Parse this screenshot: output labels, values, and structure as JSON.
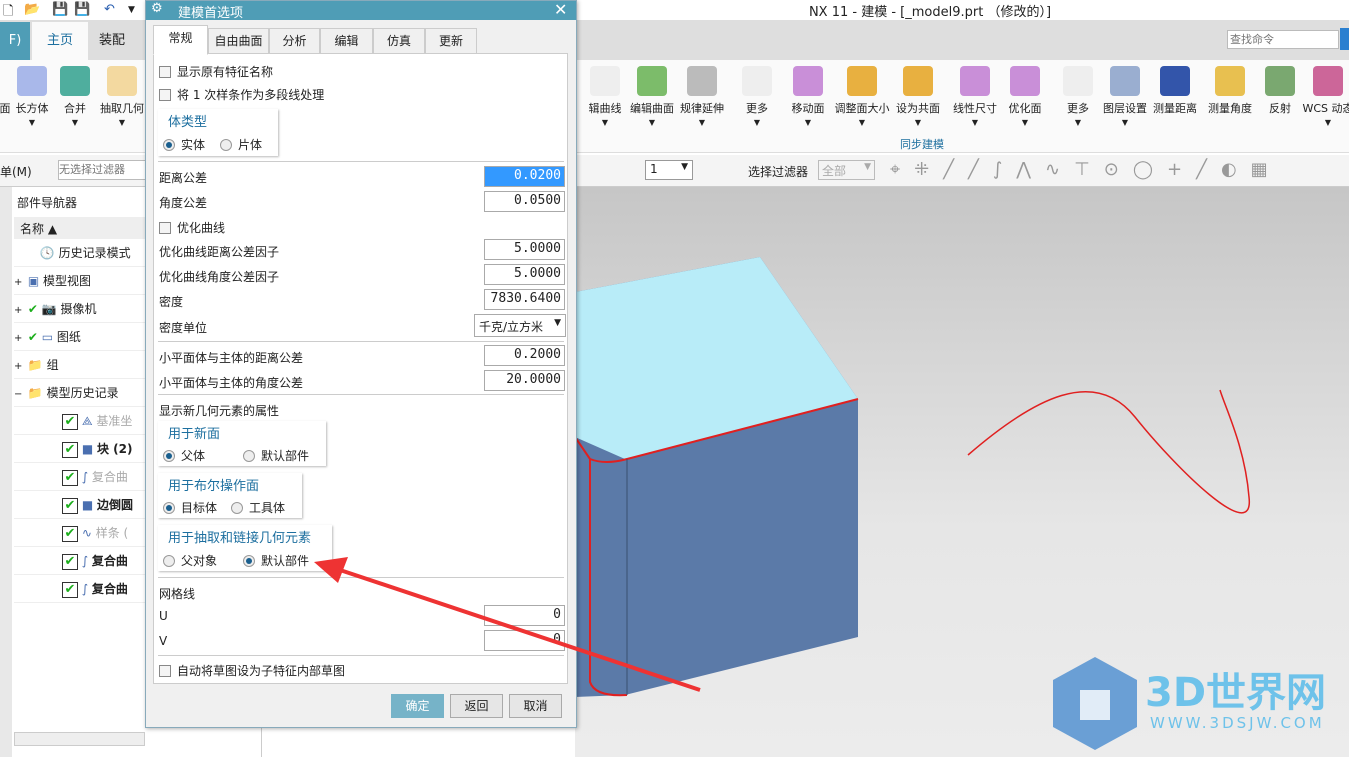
{
  "app": {
    "title": "NX 11 - 建模 - [_model9.prt （修改的）]"
  },
  "ribbon": {
    "file_tab": "F)",
    "tabs": [
      {
        "label": "主页",
        "selected": true
      },
      {
        "label": "装配"
      }
    ],
    "search_placeholder": "查找命令",
    "left_buttons": [
      "面",
      "长方体",
      "合并",
      "抽取几何"
    ],
    "right_buttons": [
      "辑曲线",
      "编辑曲面",
      "规律延伸",
      "更多",
      "移动面",
      "调整面大小",
      "设为共面",
      "线性尺寸",
      "优化面",
      "更多",
      "图层设置",
      "测量距离",
      "测量角度",
      "反射",
      "WCS 动态"
    ],
    "group_label": "同步建模"
  },
  "toolbar": {
    "menu": "单(M)",
    "filter_placeholder": "无选择过滤器",
    "layer_value": "1",
    "select_filter": "选择过滤器",
    "scope": "全部"
  },
  "navigator": {
    "title": "部件导航器",
    "col_header": "名称",
    "items": [
      "历史记录模式",
      "模型视图",
      "摄像机",
      "图纸",
      "组",
      "模型历史记录",
      "基准坐",
      "块 (2)",
      "复合曲",
      "边倒圆",
      "样条 (",
      "复合曲",
      "复合曲"
    ]
  },
  "dialog": {
    "title": "建模首选项",
    "tabs": [
      "常规",
      "自由曲面",
      "分析",
      "编辑",
      "仿真",
      "更新"
    ],
    "active_tab": "常规",
    "show_orig_names": "显示原有特征名称",
    "spline_polyline": "将 1 次样条作为多段线处理",
    "body_type": {
      "title": "体类型",
      "options": [
        "实体",
        "片体"
      ],
      "selected": "实体"
    },
    "dist_tol": {
      "label": "距离公差",
      "value": "0.0200"
    },
    "angle_tol": {
      "label": "角度公差",
      "value": "0.0500"
    },
    "optimize_curve": "优化曲线",
    "opt_dist": {
      "label": "优化曲线距离公差因子",
      "value": "5.0000"
    },
    "opt_angle": {
      "label": "优化曲线角度公差因子",
      "value": "5.0000"
    },
    "density": {
      "label": "密度",
      "value": "7830.6400"
    },
    "density_unit": {
      "label": "密度单位",
      "value": "千克/立方米"
    },
    "facet_dist": {
      "label": "小平面体与主体的距离公差",
      "value": "0.2000"
    },
    "facet_angle": {
      "label": "小平面体与主体的角度公差",
      "value": "20.0000"
    },
    "new_geom": "显示新几何元素的属性",
    "new_face": {
      "title": "用于新面",
      "options": [
        "父体",
        "默认部件"
      ],
      "selected": "父体"
    },
    "boolean_face": {
      "title": "用于布尔操作面",
      "options": [
        "目标体",
        "工具体"
      ],
      "selected": "目标体"
    },
    "extract": {
      "title": "用于抽取和链接几何元素",
      "options": [
        "父对象",
        "默认部件"
      ],
      "selected": "默认部件"
    },
    "grid": {
      "label": "网格线",
      "u_label": "U",
      "u": "0",
      "v_label": "V",
      "v": "0"
    },
    "auto_sketch": "自动将草图设为子特征内部草图",
    "ok": "确定",
    "back": "返回",
    "cancel": "取消"
  },
  "watermark": {
    "text": "3D世界网",
    "url": "WWW.3DSJW.COM"
  },
  "colors": {
    "dialog_title": "#4f9db6",
    "ok_button": "#76b3c8",
    "accent_text": "#1d6f9f",
    "arrow": "#ee3333",
    "body_face": "#5b7aa8",
    "top_face": "#b8ecf8"
  }
}
